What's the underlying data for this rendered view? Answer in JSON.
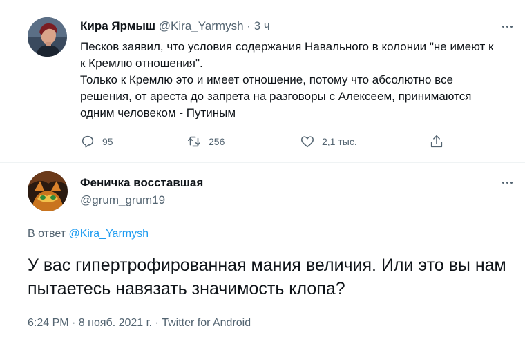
{
  "tweet": {
    "author_name": "Кира Ярмыш",
    "author_handle": "@Kira_Yarmysh",
    "separator": "·",
    "time": "3 ч",
    "text_lines": [
      "Песков заявил, что условия содержания Навального в колонии \"не имеют к к Кремлю отношения\".",
      "Только к Кремлю это и имеет отношение, потому что абсолютно все решения, от ареста до запрета на разговоры с Алексеем, принимаются одним человеком - Путиным"
    ],
    "stats": {
      "replies": "95",
      "retweets": "256",
      "likes": "2,1 тыс."
    },
    "icons": [
      "reply-icon",
      "retweet-icon",
      "like-icon",
      "share-icon",
      "more-icon"
    ]
  },
  "reply": {
    "author_name": "Феничка восставшая",
    "author_handle": "@grum_grum19",
    "reply_prefix": "В ответ",
    "reply_mention": "@Kira_Yarmysh",
    "text": "У вас гипертрофированная мания величия. Или это вы нам пытаетесь навязать значимость клопа?",
    "meta": "6:24 PM · 8 нояб. 2021 г. · Twitter for Android"
  },
  "colors": {
    "text": "#0f1419",
    "secondary": "#536471",
    "link": "#1d9bf0",
    "divider": "#eff3f4"
  }
}
